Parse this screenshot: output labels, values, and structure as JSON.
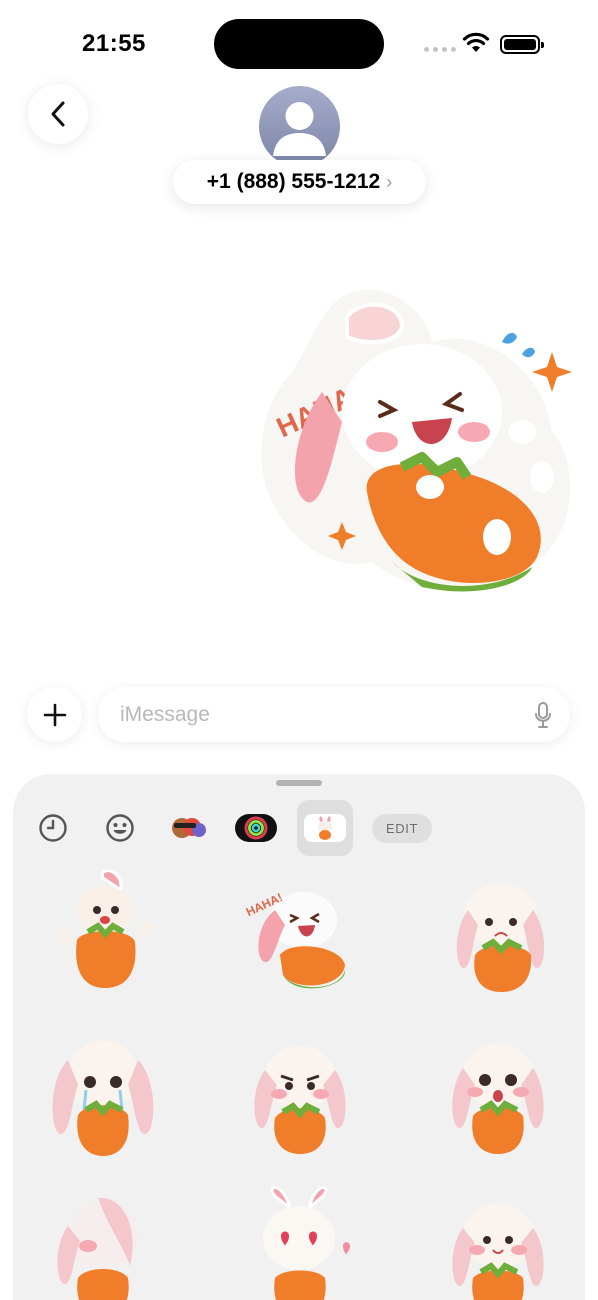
{
  "status_bar": {
    "time": "21:55"
  },
  "header": {
    "contact": "+1 (888) 555-1212",
    "chevron": "›",
    "back_icon": "chevron-left-icon"
  },
  "conversation": {
    "sticker_text": "HAHAHA!"
  },
  "compose": {
    "placeholder": "iMessage",
    "plus_icon": "plus-icon",
    "mic_icon": "microphone-icon"
  },
  "sticker_panel": {
    "tabs": [
      "recents-icon",
      "emoji-icon",
      "memoji-icon",
      "activity-rings-icon",
      "bunny-sticker-pack-icon"
    ],
    "active_tab": 4,
    "edit_label": "EDIT",
    "stickers": [
      "bunny-waving-sticker",
      "bunny-laughing-sticker",
      "bunny-worried-sticker",
      "bunny-crying-sticker",
      "bunny-angry-sticker",
      "bunny-surprised-sticker",
      "bunny-shy-sticker",
      "bunny-love-sticker",
      "bunny-happy-sticker"
    ]
  },
  "colors": {
    "accent_orange": "#f07d2a",
    "leaf_green": "#6fae3b",
    "ear_pink": "#f4a3ad",
    "panel_bg": "#f1f1f1"
  }
}
